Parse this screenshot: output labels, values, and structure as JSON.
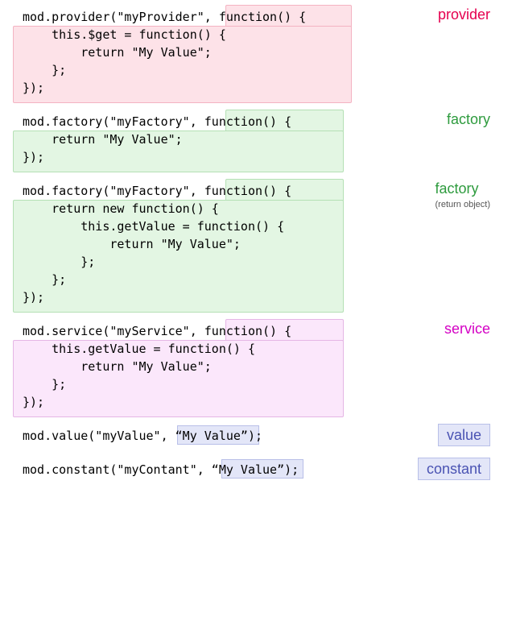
{
  "labels": {
    "provider": "provider",
    "factory": "factory",
    "factory_sub": "(return object)",
    "service": "service",
    "value": "value",
    "constant": "constant"
  },
  "code": {
    "provider": "mod.provider(\"myProvider\", function() {\n    this.$get = function() {\n        return \"My Value\";\n    };\n});",
    "factory1": "mod.factory(\"myFactory\", function() {\n    return \"My Value\";\n});",
    "factory2": "mod.factory(\"myFactory\", function() {\n    return new function() {\n        this.getValue = function() {\n            return \"My Value\";\n        };\n    };\n});",
    "service": "mod.service(\"myService\", function() {\n    this.getValue = function() {\n        return \"My Value\";\n    };\n});",
    "value": "mod.value(\"myValue\", “My Value”);",
    "constant": "mod.constant(\"myContant\", “My Value”);"
  }
}
